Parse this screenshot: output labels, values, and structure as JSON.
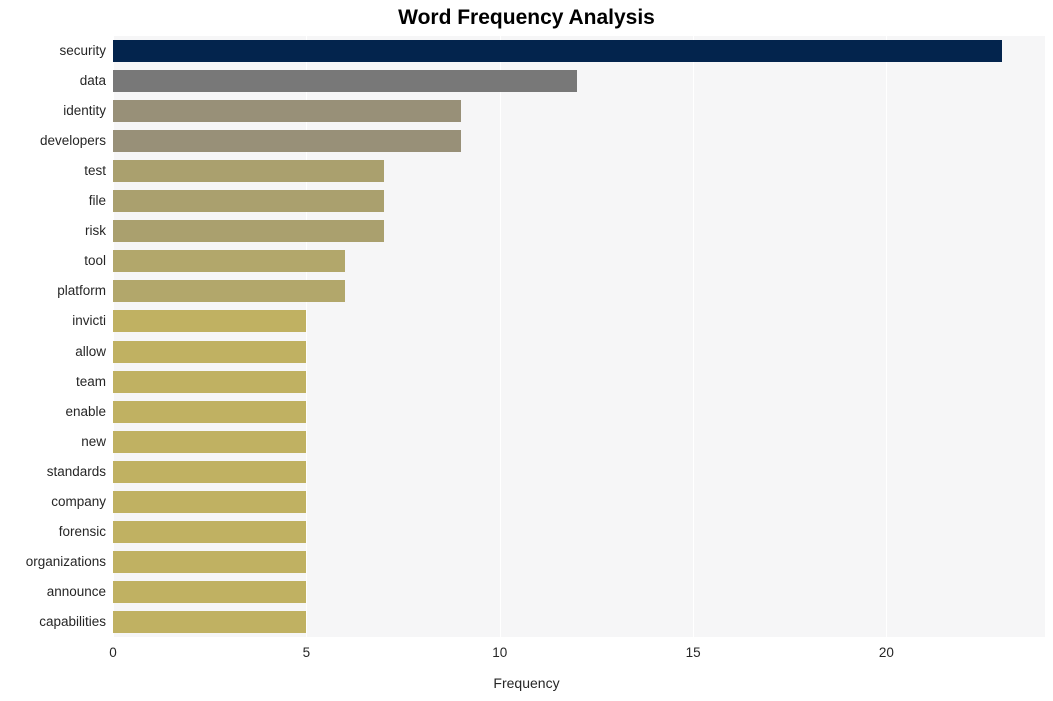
{
  "chart_data": {
    "type": "bar",
    "orientation": "horizontal",
    "title": "Word Frequency Analysis",
    "xlabel": "Frequency",
    "ylabel": "",
    "xlim": [
      0,
      24.1
    ],
    "ylim": [
      0,
      20
    ],
    "xticks": [
      "0",
      "5",
      "10",
      "15",
      "20"
    ],
    "xtick_values": [
      0,
      5,
      10,
      15,
      20
    ],
    "grid": "vertical-white-on-light-gray",
    "legend": "none",
    "categories": [
      "security",
      "data",
      "identity",
      "developers",
      "test",
      "file",
      "risk",
      "tool",
      "platform",
      "invicti",
      "allow",
      "team",
      "enable",
      "new",
      "standards",
      "company",
      "forensic",
      "organizations",
      "announce",
      "capabilities"
    ],
    "values": [
      23,
      12,
      9,
      9,
      7,
      7,
      7,
      6,
      6,
      5,
      5,
      5,
      5,
      5,
      5,
      5,
      5,
      5,
      5,
      5
    ],
    "bar_colors": [
      "#03244d",
      "#787878",
      "#989078",
      "#989078",
      "#aaa06e",
      "#aaa06e",
      "#aaa06e",
      "#b2a76b",
      "#b2a76b",
      "#c0b162",
      "#c0b162",
      "#c0b162",
      "#c0b162",
      "#c0b162",
      "#c0b162",
      "#c0b162",
      "#c0b162",
      "#c0b162",
      "#c0b162",
      "#c0b162"
    ],
    "plot_background": "#f6f6f7",
    "figure_background": "#ffffff",
    "gridline_color": "#ffffff",
    "text_color": "#262626"
  }
}
